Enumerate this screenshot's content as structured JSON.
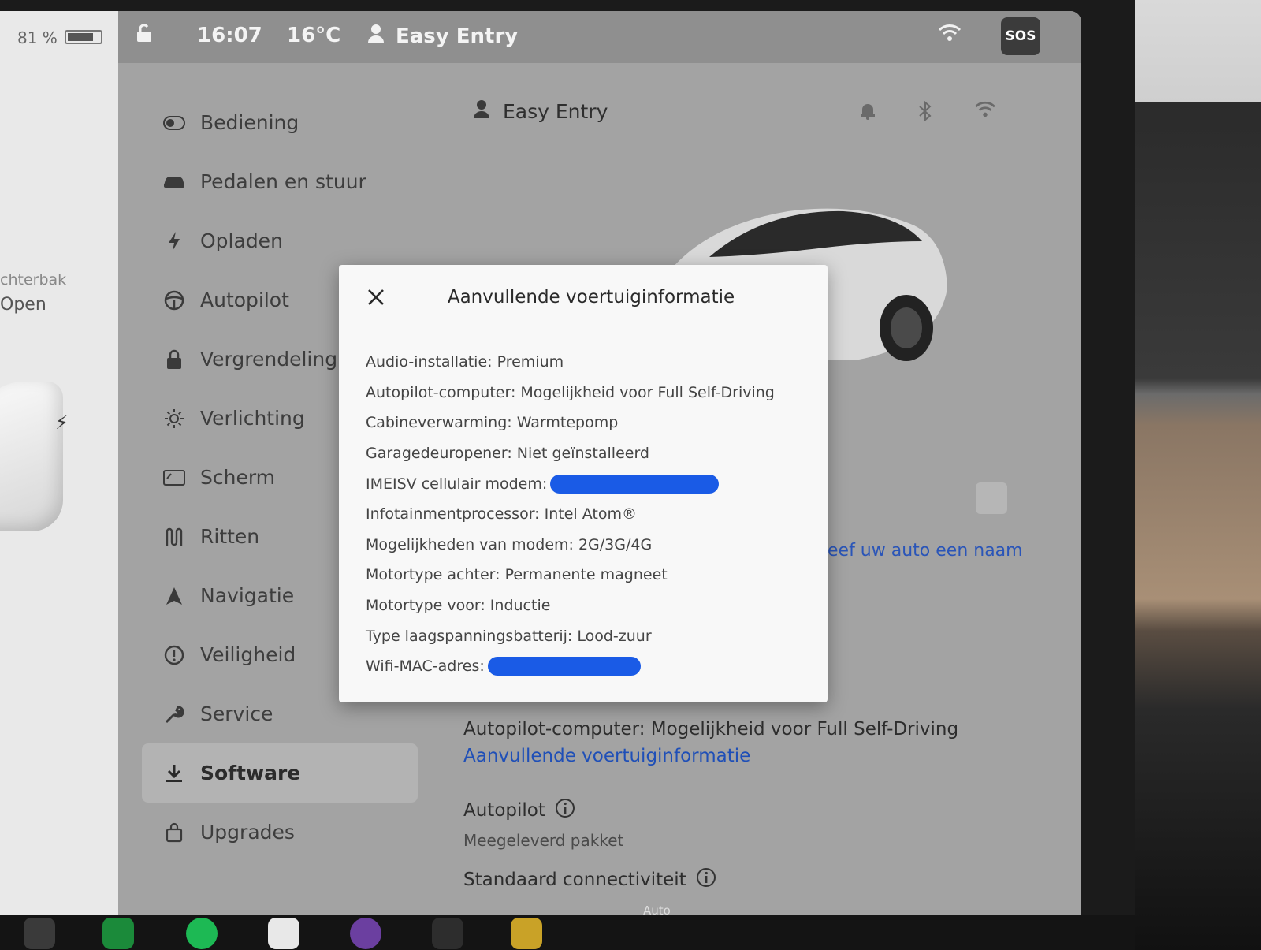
{
  "status_bar": {
    "battery_percent": "81 %",
    "battery_level": 0.81,
    "time": "16:07",
    "temperature": "16°C",
    "profile_name": "Easy Entry",
    "sos_label": "SOS"
  },
  "left_panel": {
    "trunk_label": "chterbak",
    "trunk_state": "Open"
  },
  "sidebar": {
    "items": [
      {
        "label": "Bediening",
        "icon": "toggle-icon"
      },
      {
        "label": "Pedalen en stuur",
        "icon": "car-icon"
      },
      {
        "label": "Opladen",
        "icon": "bolt-icon"
      },
      {
        "label": "Autopilot",
        "icon": "steering-wheel-icon"
      },
      {
        "label": "Vergrendeling",
        "icon": "lock-icon"
      },
      {
        "label": "Verlichting",
        "icon": "sun-icon"
      },
      {
        "label": "Scherm",
        "icon": "display-icon"
      },
      {
        "label": "Ritten",
        "icon": "trips-icon"
      },
      {
        "label": "Navigatie",
        "icon": "navigation-arrow-icon"
      },
      {
        "label": "Veiligheid",
        "icon": "alert-circle-icon"
      },
      {
        "label": "Service",
        "icon": "wrench-icon"
      },
      {
        "label": "Software",
        "icon": "download-icon",
        "active": true
      },
      {
        "label": "Upgrades",
        "icon": "shopping-bag-icon"
      }
    ]
  },
  "content": {
    "profile_name": "Easy Entry",
    "name_link": "eef uw auto een naam",
    "autopilot_computer_line": "Autopilot-computer: Mogelijkheid voor Full Self-Driving",
    "more_info_link": "Aanvullende voertuiginformatie",
    "autopilot_title": "Autopilot",
    "autopilot_sub": "Meegeleverd pakket",
    "connectivity_title": "Standaard connectiviteit"
  },
  "dock": {
    "auto_label": "Auto"
  },
  "modal": {
    "title": "Aanvullende voertuiginformatie",
    "rows": [
      {
        "text": "Audio-installatie: Premium"
      },
      {
        "text": "Autopilot-computer: Mogelijkheid voor Full Self-Driving"
      },
      {
        "text": "Cabineverwarming: Warmtepomp"
      },
      {
        "text": "Garagedeuropener: Niet geïnstalleerd"
      },
      {
        "text": "IMEISV cellulair modem:",
        "redacted": true
      },
      {
        "text": "Infotainmentprocessor: Intel Atom®"
      },
      {
        "text": "Mogelijkheden van modem: 2G/3G/4G"
      },
      {
        "text": "Motortype achter: Permanente magneet"
      },
      {
        "text": "Motortype voor: Inductie"
      },
      {
        "text": "Type laagspanningsbatterij: Lood-zuur"
      },
      {
        "text": "Wifi-MAC-adres:",
        "redacted": true
      }
    ]
  },
  "colors": {
    "link_blue": "#1f4fb7",
    "redaction_blue": "#1a5be6",
    "screen_grey": "#a3a3a3"
  }
}
